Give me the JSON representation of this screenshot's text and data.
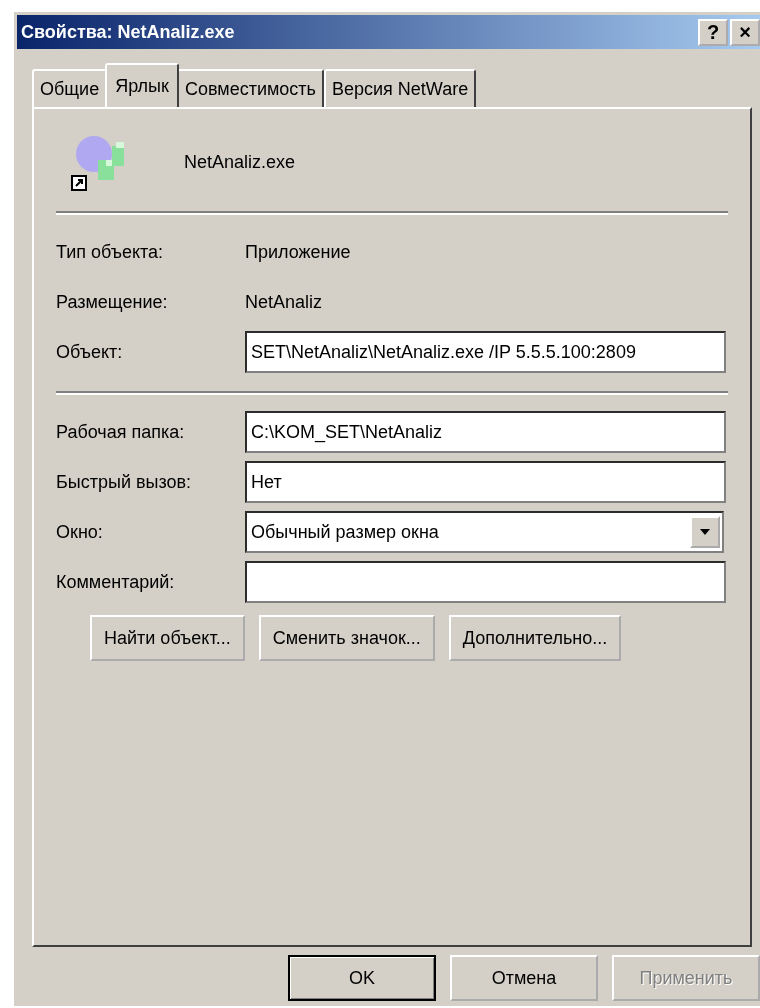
{
  "window": {
    "title": "Свойства: NetAnaliz.exe",
    "help_button": "?",
    "close_button": "×"
  },
  "tabs": [
    {
      "label": "Общие",
      "selected": false
    },
    {
      "label": "Ярлык",
      "selected": true
    },
    {
      "label": "Совместимость",
      "selected": false
    },
    {
      "label": "Версия NetWare",
      "selected": false
    }
  ],
  "header": {
    "name": "NetAnaliz.exe"
  },
  "sections": [
    {
      "rows": [
        {
          "kind": "info",
          "label": "Тип объекта:",
          "value": "Приложение"
        },
        {
          "kind": "info",
          "label": "Размещение:",
          "value": "NetAnaliz"
        },
        {
          "kind": "input",
          "label": "Объект:",
          "value": "SET\\NetAnaliz\\NetAnaliz.exe /IP 5.5.5.100:2809"
        }
      ]
    },
    {
      "rows": [
        {
          "kind": "input",
          "label": "Рабочая папка:",
          "value": "C:\\KOM_SET\\NetAnaliz"
        },
        {
          "kind": "input",
          "label": "Быстрый вызов:",
          "value": "Нет"
        },
        {
          "kind": "combo",
          "label": "Окно:",
          "value": "Обычный размер окна"
        },
        {
          "kind": "input",
          "label": "Комментарий:",
          "value": ""
        }
      ]
    }
  ],
  "actions": [
    {
      "label": "Найти объект..."
    },
    {
      "label": "Сменить значок..."
    },
    {
      "label": "Дополнительно..."
    }
  ],
  "buttons": [
    {
      "label": "OK",
      "default": true,
      "disabled": false
    },
    {
      "label": "Отмена",
      "default": false,
      "disabled": false
    },
    {
      "label": "Применить",
      "default": false,
      "disabled": true
    }
  ]
}
